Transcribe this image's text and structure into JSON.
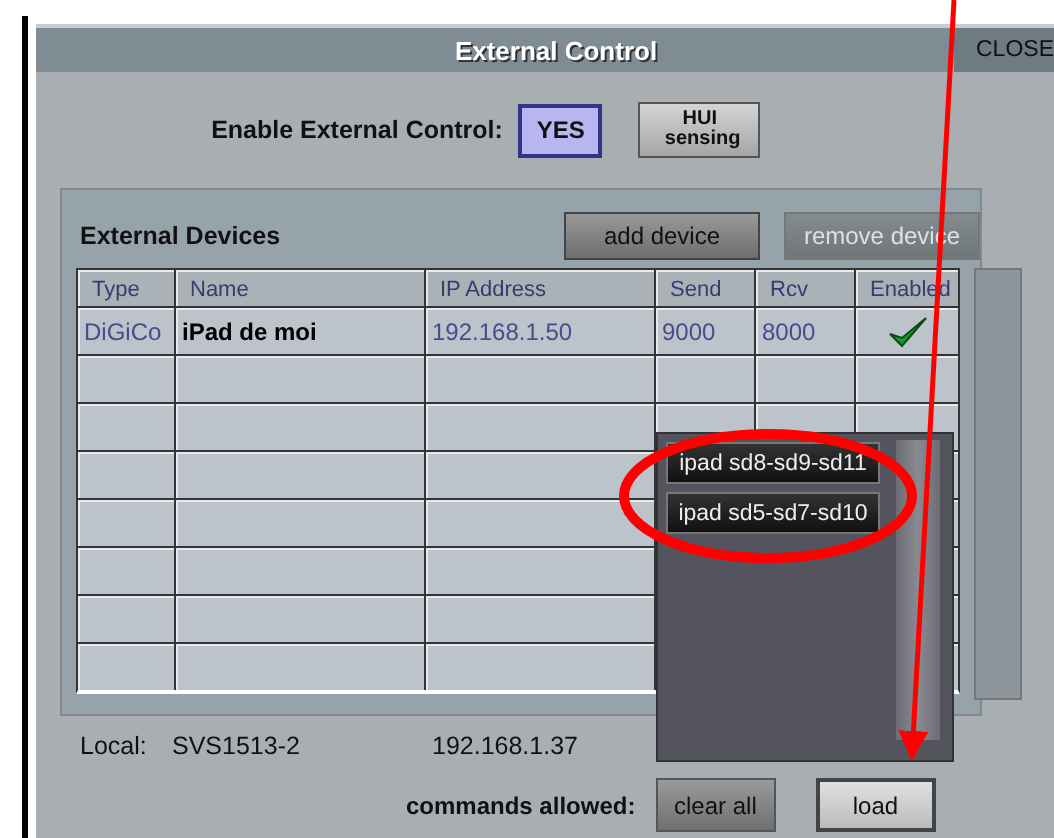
{
  "window": {
    "title": "External Control",
    "close": "CLOSE"
  },
  "enable": {
    "label": "Enable External Control:",
    "buttons": [
      {
        "label": "YES",
        "selected": true
      },
      {
        "label": "HUI sensing",
        "selected": false
      }
    ]
  },
  "devices": {
    "title": "External Devices",
    "buttons": [
      {
        "label": "add device",
        "disabled": false
      },
      {
        "label": "remove device",
        "disabled": true
      }
    ],
    "columns": [
      "Type",
      "Name",
      "IP Address",
      "Send",
      "Rcv",
      "Enabled"
    ],
    "rows": [
      {
        "type": "DiGiCo",
        "name": "iPad de moi",
        "ip": "192.168.1.50",
        "send": "9000",
        "rcv": "8000",
        "enabled": true
      }
    ]
  },
  "popup": {
    "items": [
      "ipad sd8-sd9-sd11",
      "ipad sd5-sd7-sd10"
    ]
  },
  "local": {
    "label": "Local:",
    "name": "SVS1513-2",
    "ip": "192.168.1.37"
  },
  "commands": {
    "label": "commands allowed:",
    "buttons": [
      "clear all",
      "load"
    ]
  }
}
